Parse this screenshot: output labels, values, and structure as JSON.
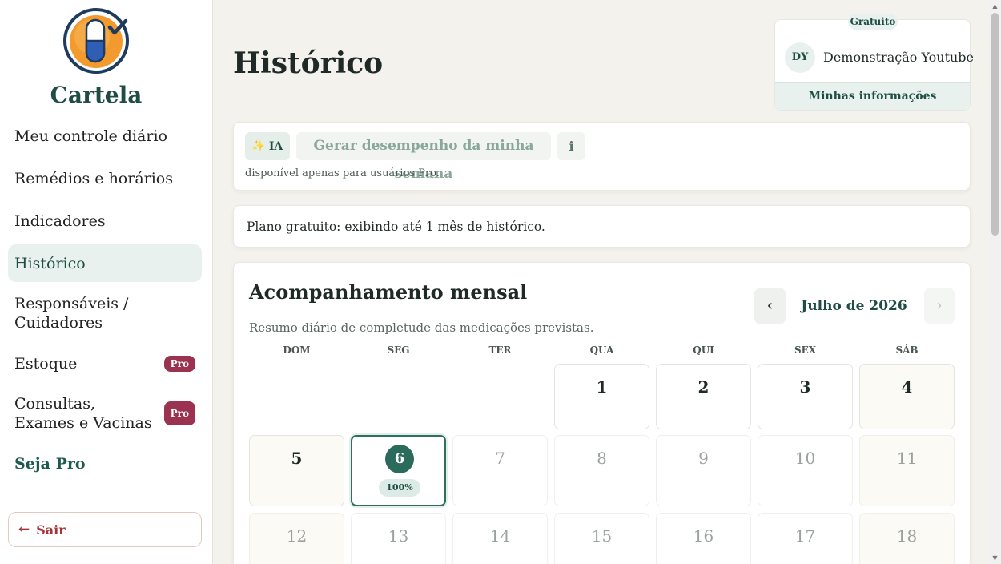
{
  "app": {
    "brand": "Cartela",
    "logo_icon": "pill-check-icon"
  },
  "sidebar": {
    "items": [
      {
        "label": "Meu controle diário"
      },
      {
        "label": "Remédios e horários"
      },
      {
        "label": "Indicadores"
      },
      {
        "label": "Histórico",
        "active": true
      },
      {
        "label": "Responsáveis / Cuidadores"
      },
      {
        "label": "Estoque",
        "badge": "Pro"
      },
      {
        "label": "Consultas, Exames e Vacinas",
        "badge": "Pro"
      },
      {
        "label": "Seja Pro"
      }
    ],
    "logout_label": "Sair",
    "logout_icon": "arrow-left-icon"
  },
  "page": {
    "title": "Histórico"
  },
  "user": {
    "plan": "Gratuito",
    "initials": "DY",
    "name": "Demonstração Youtube",
    "info_link": "Minhas informações"
  },
  "ai": {
    "badge": "IA",
    "badge_icon": "sparkle-icon",
    "button_label": "Gerar desempenho da minha semana",
    "info_label": "i",
    "note": "disponível apenas para usuários Pro."
  },
  "plan_notice": "Plano gratuito: exibindo até 1 mês de histórico.",
  "calendar": {
    "title": "Acompanhamento mensal",
    "subtitle": "Resumo diário de completude das medicações previstas.",
    "month_label": "Julho de 2026",
    "prev_icon": "chevron-left-icon",
    "next_icon": "chevron-right-icon",
    "weekdays": [
      "DOM",
      "SEG",
      "TER",
      "QUA",
      "QUI",
      "SEX",
      "SÁB"
    ],
    "rows": [
      [
        "",
        "",
        "",
        "1",
        "2",
        "3",
        "4"
      ],
      [
        "5",
        "6",
        "7",
        "8",
        "9",
        "10",
        "11"
      ],
      [
        "12",
        "13",
        "14",
        "15",
        "16",
        "17",
        "18"
      ]
    ],
    "today": "6",
    "today_completion": "100%"
  },
  "colors": {
    "accent": "#1f4d43",
    "pro_badge": "#9b3350",
    "logout": "#a4333a",
    "active_nav_bg": "#e8f1ed"
  }
}
